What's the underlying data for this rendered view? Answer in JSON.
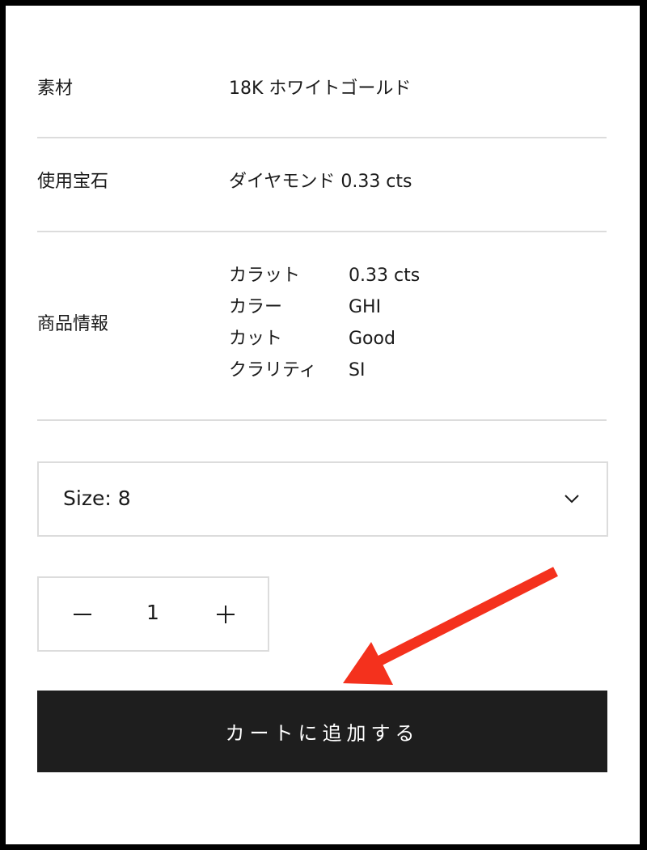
{
  "specs": [
    {
      "label": "素材",
      "value": "18K ホワイトゴールド"
    },
    {
      "label": "使用宝石",
      "value": "ダイヤモンド 0.33 cts"
    },
    {
      "label": "商品情報"
    }
  ],
  "product_details": [
    {
      "key": "カラット",
      "value": "0.33 cts"
    },
    {
      "key": "カラー",
      "value": "GHI"
    },
    {
      "key": "カット",
      "value": "Good"
    },
    {
      "key": "クラリティ",
      "value": "SI"
    }
  ],
  "size_select": {
    "selected": "Size: 8",
    "icon": "chevron-down-icon"
  },
  "quantity": {
    "value": "1",
    "decrement_icon": "minus-icon",
    "increment_icon": "plus-icon"
  },
  "cart_button": {
    "label": "カートに追加する"
  },
  "annotation": {
    "icon": "red-arrow-icon",
    "color": "#f4311d"
  }
}
